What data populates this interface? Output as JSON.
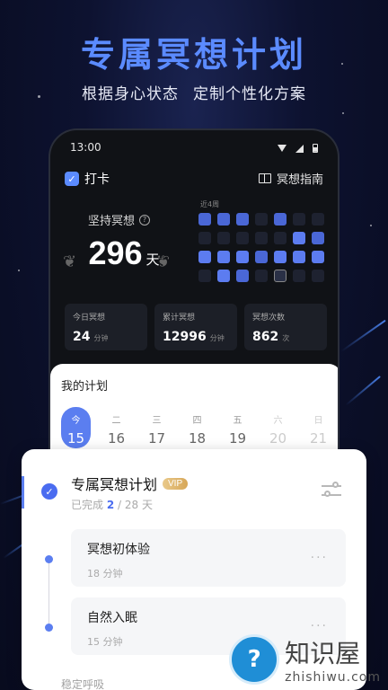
{
  "headline": "专属冥想计划",
  "subline": [
    "根据身心状态",
    "定制个性化方案"
  ],
  "status_bar": {
    "time": "13:00"
  },
  "top_bar": {
    "checkin_label": "打卡",
    "guide_label": "冥想指南"
  },
  "streak": {
    "label": "坚持冥想",
    "days": "296",
    "unit": "天"
  },
  "grid": {
    "title": "近4周",
    "levels": [
      1,
      1,
      1,
      0,
      1,
      0,
      0,
      0,
      0,
      0,
      0,
      0,
      2,
      1,
      2,
      2,
      2,
      1,
      2,
      2,
      2,
      0,
      2,
      1,
      0,
      3,
      0,
      0
    ]
  },
  "stats": [
    {
      "title": "今日冥想",
      "value": "24",
      "unit": "分钟"
    },
    {
      "title": "累计冥想",
      "value": "12996",
      "unit": "分钟"
    },
    {
      "title": "冥想次数",
      "value": "862",
      "unit": "次"
    }
  ],
  "plan": {
    "title": "我的计划",
    "week": [
      {
        "wd": "今",
        "dn": "15"
      },
      {
        "wd": "二",
        "dn": "16"
      },
      {
        "wd": "三",
        "dn": "17"
      },
      {
        "wd": "四",
        "dn": "18"
      },
      {
        "wd": "五",
        "dn": "19"
      },
      {
        "wd": "六",
        "dn": "20"
      },
      {
        "wd": "日",
        "dn": "21"
      }
    ]
  },
  "program": {
    "title": "专属冥想计划",
    "badge": "VIP",
    "progress_prefix": "已完成",
    "progress_done": "2",
    "progress_total": "/ 28 天",
    "sessions": [
      {
        "name": "冥想初体验",
        "duration": "18 分钟"
      },
      {
        "name": "自然入眠",
        "duration": "15 分钟"
      }
    ],
    "more": "···",
    "next_hint": "稳定呼吸"
  },
  "watermark": {
    "cn": "知识屋",
    "en": "zhishiwu.com",
    "logo_glyph": "?"
  },
  "colors": {
    "accent": "#5b7ef0",
    "headline": "#5b8bff",
    "vip": "#d7a758"
  }
}
